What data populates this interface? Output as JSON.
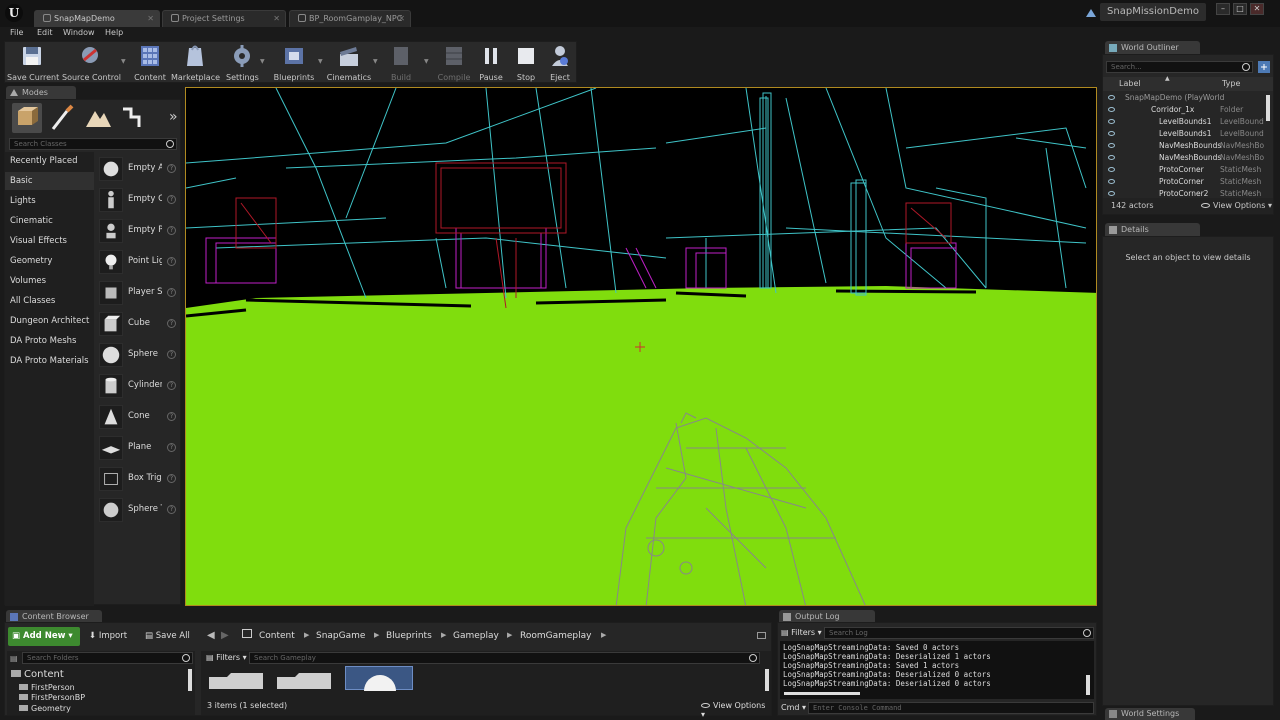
{
  "window": {
    "tabs": [
      {
        "label": "SnapMapDemo"
      },
      {
        "label": "Project Settings"
      },
      {
        "label": "BP_RoomGamplay_NPC"
      }
    ],
    "project_name": "SnapMissionDemo"
  },
  "menu": [
    "File",
    "Edit",
    "Window",
    "Help"
  ],
  "toolbar": {
    "buttons": [
      {
        "label": "Save Current",
        "icon": "save-icon"
      },
      {
        "label": "Source Control",
        "icon": "source-control-icon"
      },
      {
        "label": "Content",
        "icon": "content-icon"
      },
      {
        "label": "Marketplace",
        "icon": "marketplace-icon"
      },
      {
        "label": "Settings",
        "icon": "gear-icon"
      },
      {
        "label": "Blueprints",
        "icon": "blueprints-icon"
      },
      {
        "label": "Cinematics",
        "icon": "clapper-icon"
      },
      {
        "label": "Build",
        "icon": "build-icon"
      },
      {
        "label": "Compile",
        "icon": "compile-icon"
      },
      {
        "label": "Pause",
        "icon": "pause-icon"
      },
      {
        "label": "Stop",
        "icon": "stop-icon"
      },
      {
        "label": "Eject",
        "icon": "eject-icon"
      }
    ]
  },
  "modes": {
    "tab": "Modes",
    "search_placeholder": "Search Classes",
    "categories": [
      "Recently Placed",
      "Basic",
      "Lights",
      "Cinematic",
      "Visual Effects",
      "Geometry",
      "Volumes",
      "All Classes",
      "Dungeon Architect",
      "DA Proto Meshs",
      "DA Proto Materials"
    ],
    "active_category": "Basic",
    "items": [
      "Empty A",
      "Empty Cl",
      "Empty P",
      "Point Lig",
      "Player S",
      "Cube",
      "Sphere",
      "Cylinder",
      "Cone",
      "Plane",
      "Box Trig",
      "Sphere T"
    ]
  },
  "world_outliner": {
    "tab": "World Outliner",
    "search_placeholder": "Search...",
    "col_label": "Label",
    "col_type": "Type",
    "rows": [
      {
        "name": "SnapMapDemo (PlayWorld",
        "type": ""
      },
      {
        "name": "Corridor_1x",
        "type": "Folder"
      },
      {
        "name": "LevelBounds1",
        "type": "LevelBound"
      },
      {
        "name": "LevelBounds1",
        "type": "LevelBound"
      },
      {
        "name": "NavMeshBounds",
        "type": "NavMeshBo"
      },
      {
        "name": "NavMeshBounds",
        "type": "NavMeshBo"
      },
      {
        "name": "ProtoCorner",
        "type": "StaticMesh"
      },
      {
        "name": "ProtoCorner",
        "type": "StaticMesh"
      },
      {
        "name": "ProtoCorner2",
        "type": "StaticMesh"
      }
    ],
    "actor_count": "142 actors",
    "view_options": "View Options"
  },
  "details": {
    "tab": "Details",
    "empty_text": "Select an object to view details"
  },
  "content_browser": {
    "tab": "Content Browser",
    "add_new": "Add New",
    "import": "Import",
    "save_all": "Save All",
    "breadcrumb": [
      "Content",
      "SnapGame",
      "Blueprints",
      "Gameplay",
      "RoomGameplay"
    ],
    "folder_search": "Search Folders",
    "filters": "Filters",
    "asset_search": "Search Gameplay",
    "tree": [
      "Content",
      "FirstPerson",
      "FirstPersonBP",
      "Geometry"
    ],
    "status": "3 items (1 selected)",
    "view_options": "View Options"
  },
  "output_log": {
    "tab": "Output Log",
    "filters": "Filters",
    "search_placeholder": "Search Log",
    "lines": [
      "LogSnapMapStreamingData: Saved 0 actors",
      "LogSnapMapStreamingData: Deserialized 1 actors",
      "LogSnapMapStreamingData: Saved 1 actors",
      "LogSnapMapStreamingData: Deserialized 0 actors",
      "LogSnapMapStreamingData: Deserialized 0 actors"
    ],
    "cmd_label": "Cmd",
    "cmd_placeholder": "Enter Console Command"
  },
  "world_settings_tab": "World Settings",
  "colors": {
    "floor": "#80dd0d",
    "cyan_wire": "#3fc4c8",
    "magenta_wire": "#c020c8",
    "red_wire": "#b01828",
    "add_new_green": "#3d8a2f"
  }
}
